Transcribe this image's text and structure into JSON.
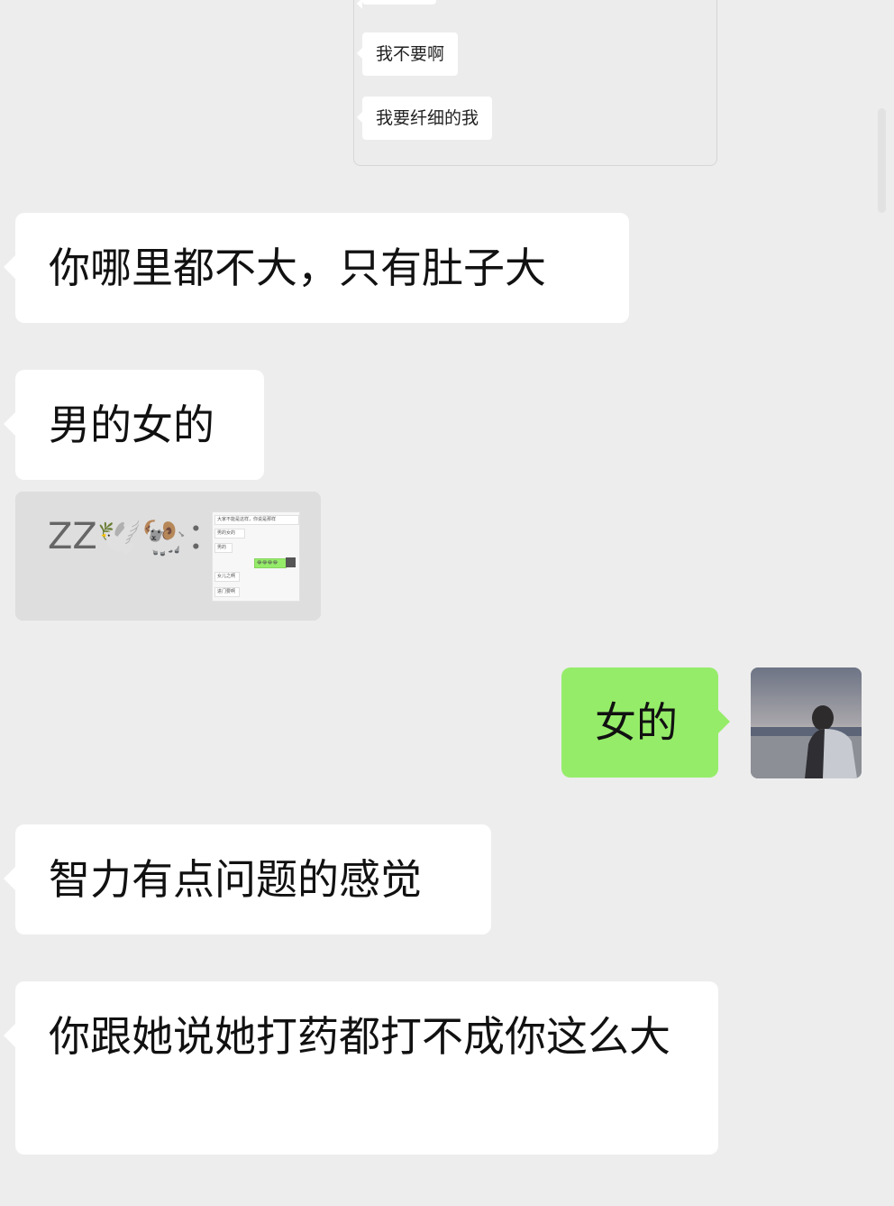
{
  "quoted_screenshot": {
    "messages": [
      {
        "text": ""
      },
      {
        "text": "我不要啊"
      },
      {
        "text": "我要纤细的我"
      }
    ]
  },
  "messages": [
    {
      "side": "left",
      "text": "你哪里都不大，只有肚子大"
    },
    {
      "side": "left",
      "text": "男的女的"
    },
    {
      "side": "left",
      "type": "card",
      "caption": "ZZ🕊️🐏：",
      "thumb_lines": [
        "大家不能是这样，你说是那样",
        "男的女的",
        "男的",
        "😂😂😂😂",
        "女儿之啊",
        "进门要啊"
      ]
    },
    {
      "side": "right",
      "text": "女的"
    },
    {
      "side": "left",
      "text": "智力有点问题的感觉"
    },
    {
      "side": "left",
      "text": "你跟她说她打药都打不成你这么大"
    }
  ],
  "colors": {
    "background": "#ededed",
    "incoming_bubble": "#ffffff",
    "outgoing_bubble": "#95ec69"
  },
  "icons": {
    "avatar": "user-avatar-photo"
  }
}
